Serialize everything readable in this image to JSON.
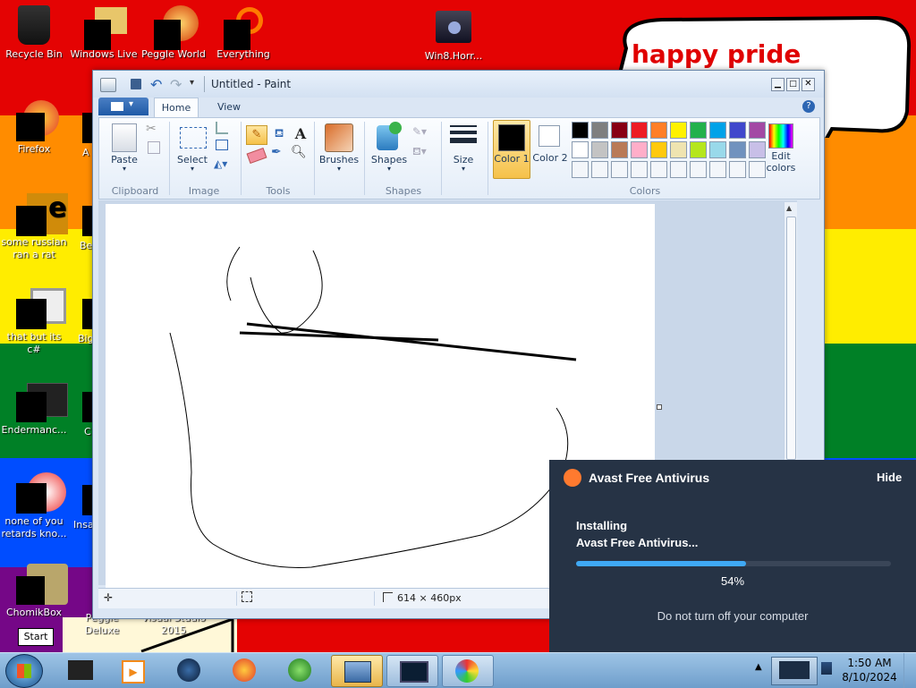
{
  "desktop": {
    "stripe_colors": [
      "#e40303",
      "#ff8c00",
      "#ffed00",
      "#008026",
      "#004dff",
      "#750787"
    ],
    "icons": [
      {
        "label": "Recycle Bin"
      },
      {
        "label": "Windows Live"
      },
      {
        "label": "Peggle World"
      },
      {
        "label": "Everything"
      },
      {
        "label": "Win8.Horr..."
      },
      {
        "label": "Firefox"
      },
      {
        "label": "some russian ran a rat"
      },
      {
        "label": "that but its c#"
      },
      {
        "label": "Endermanc..."
      },
      {
        "label": "none of you retards kno..."
      },
      {
        "label": "ChomikBox"
      },
      {
        "label": "Peggle Deluxe"
      },
      {
        "label": "Visual Studio 2015"
      }
    ],
    "partial_labels": [
      "A",
      "Be",
      "Big",
      "C",
      "Insa"
    ],
    "speech_bubble_text": "happy pride month",
    "start_label": "Start"
  },
  "paint": {
    "title": "Untitled - Paint",
    "tabs": [
      "Home",
      "View"
    ],
    "clipboard": {
      "paste": "Paste",
      "group": "Clipboard"
    },
    "image": {
      "select": "Select",
      "group": "Image"
    },
    "tools": {
      "group": "Tools"
    },
    "brushes": "Brushes",
    "shapes": {
      "label": "Shapes",
      "group": "Shapes"
    },
    "size": "Size",
    "color1": "Color 1",
    "color2": "Color 2",
    "edit_colors": "Edit colors",
    "colors_group": "Colors",
    "palette_row1": [
      "#000000",
      "#7f7f7f",
      "#880015",
      "#ed1c24",
      "#ff7f27",
      "#fff200",
      "#22b14c",
      "#00a2e8",
      "#3f48cc",
      "#a349a4"
    ],
    "palette_row2": [
      "#ffffff",
      "#c3c3c3",
      "#b97a57",
      "#ffaec9",
      "#ffc90e",
      "#efe4b0",
      "#b5e61d",
      "#99d9ea",
      "#7092be",
      "#c8bfe7"
    ],
    "canvas_size": "614 × 460px"
  },
  "avast": {
    "title": "Avast Free Antivirus",
    "hide": "Hide",
    "installing_line1": "Installing",
    "installing_line2": "Avast Free Antivirus...",
    "progress": 0.54,
    "progress_text": "54%",
    "warning": "Do not turn off your computer"
  },
  "taskbar": {
    "time": "1:50 AM",
    "date": "8/10/2024"
  }
}
